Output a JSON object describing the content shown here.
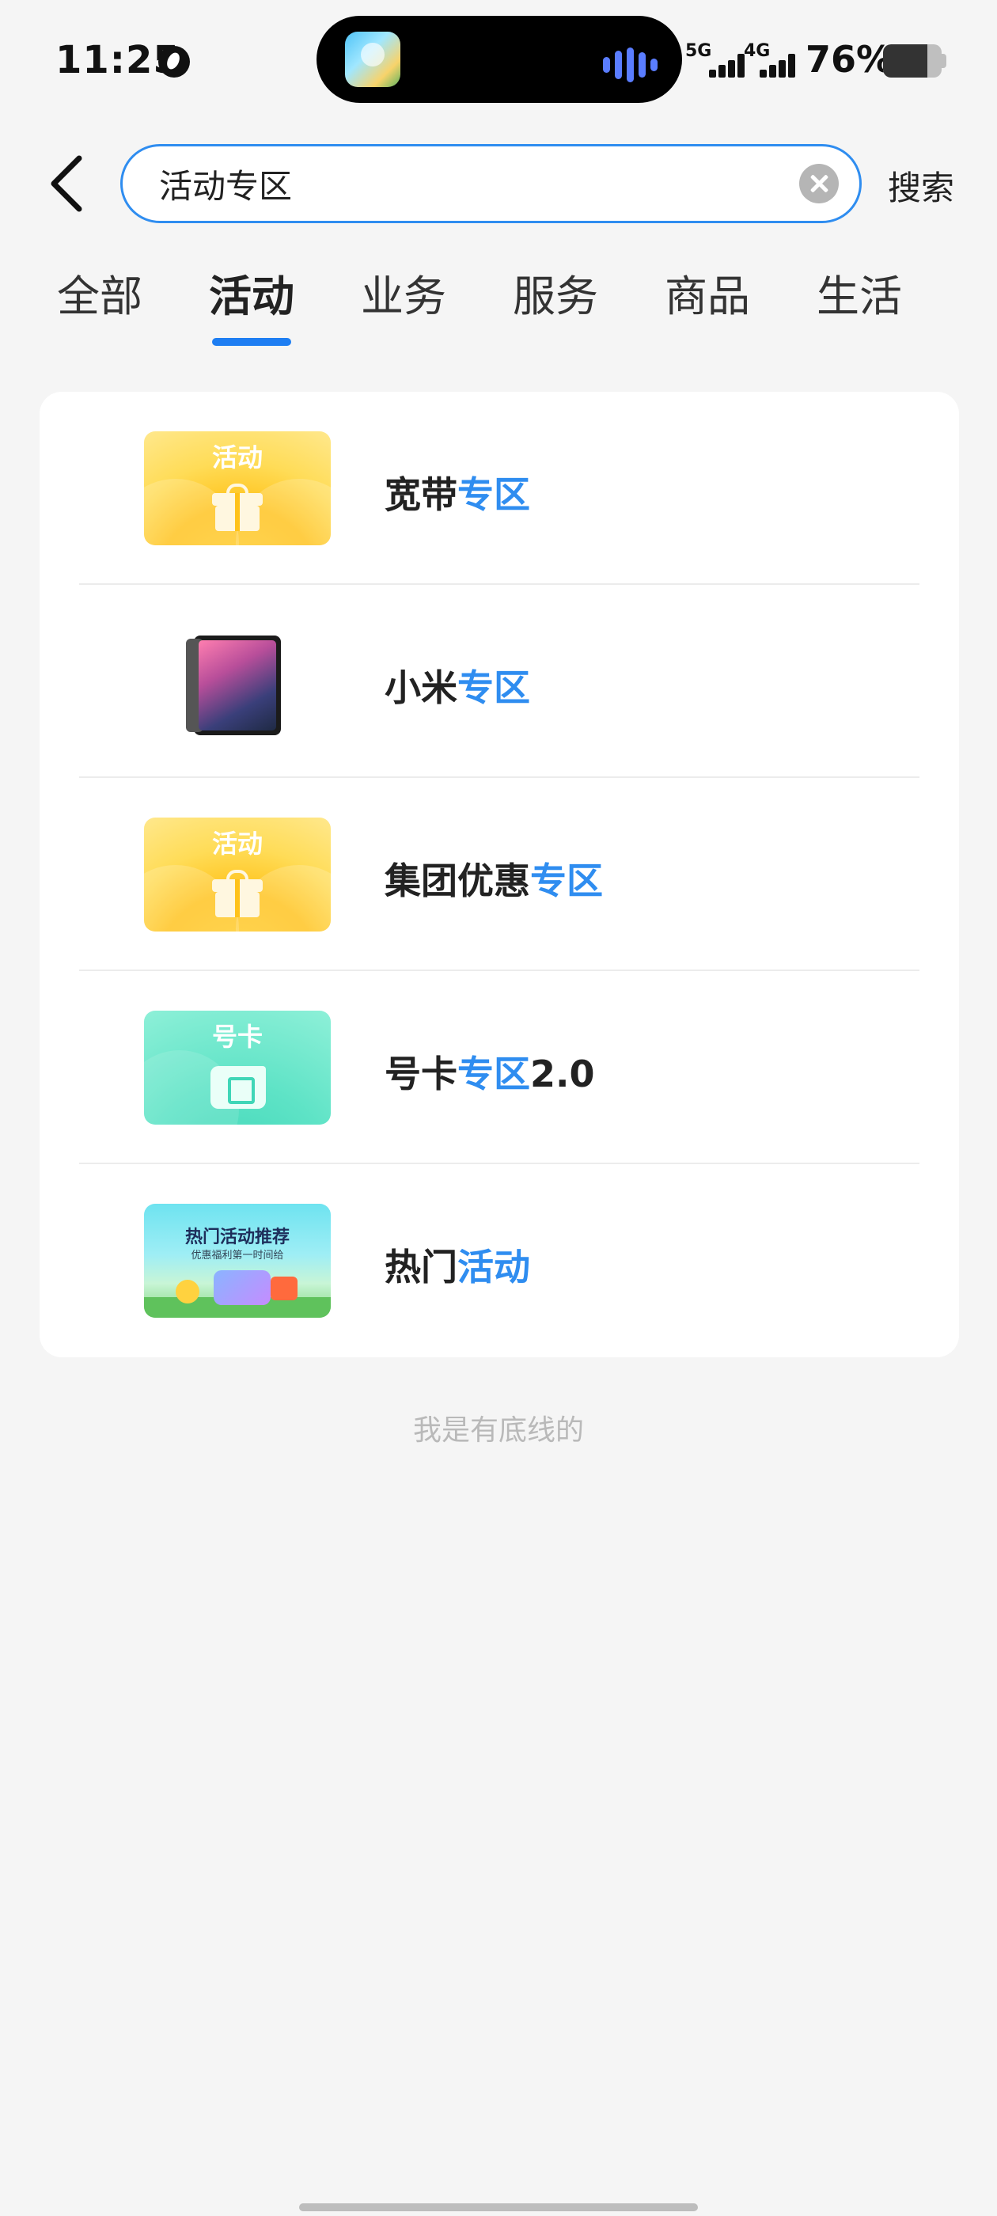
{
  "status_bar": {
    "time": "11:25",
    "signal_1": "5G",
    "signal_2": "4G",
    "battery": "76%",
    "battery_level": 0.76
  },
  "search": {
    "query": "活动专区",
    "submit_label": "搜索"
  },
  "tabs": [
    {
      "label": "全部",
      "active": false
    },
    {
      "label": "活动",
      "active": true
    },
    {
      "label": "业务",
      "active": false
    },
    {
      "label": "服务",
      "active": false
    },
    {
      "label": "商品",
      "active": false
    },
    {
      "label": "生活",
      "active": false
    }
  ],
  "results": [
    {
      "thumb": "gift",
      "thumb_label": "活动",
      "title_plain": "宽带",
      "title_highlight": "专区",
      "title_suffix": ""
    },
    {
      "thumb": "phone",
      "thumb_label": "",
      "title_plain": "小米",
      "title_highlight": "专区",
      "title_suffix": ""
    },
    {
      "thumb": "gift",
      "thumb_label": "活动",
      "title_plain": "集团优惠",
      "title_highlight": "专区",
      "title_suffix": ""
    },
    {
      "thumb": "sim",
      "thumb_label": "号卡",
      "title_plain": "号卡",
      "title_highlight": "专区",
      "title_suffix": "2.0"
    },
    {
      "thumb": "hot",
      "thumb_label": "热门活动推荐",
      "thumb_sub": "优惠福利第一时间给",
      "title_plain": "热门",
      "title_highlight": "活动",
      "title_suffix": ""
    }
  ],
  "footer_note": "我是有底线的",
  "colors": {
    "accent": "#2f8df0",
    "tab_indicator": "#1e7ef2",
    "background": "#f5f5f5"
  }
}
